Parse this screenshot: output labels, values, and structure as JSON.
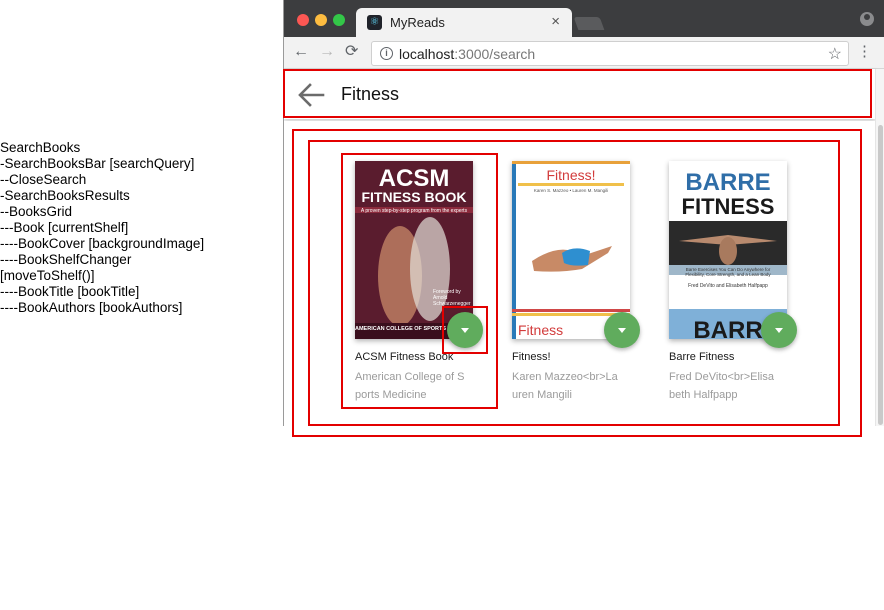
{
  "annotation": {
    "lines": [
      "SearchBooks",
      "-SearchBooksBar [searchQuery]",
      "--CloseSearch",
      "-SearchBooksResults",
      "--BooksGrid",
      "---Book  [currentShelf]",
      "----BookCover [backgroundImage]",
      "----BookShelfChanger",
      "[moveToShelf()]",
      "----BookTitle [bookTitle]",
      "----BookAuthors [bookAuthors]"
    ]
  },
  "browser": {
    "tab_title": "MyReads",
    "tab_close": "×",
    "url_host": "localhost",
    "url_path": ":3000/search",
    "nav_back": "←",
    "nav_forward": "→",
    "nav_reload": "⟳",
    "info": "i",
    "star": "☆",
    "menu": "⋮"
  },
  "search": {
    "query": "Fitness"
  },
  "books": [
    {
      "title": "ACSM Fitness Book",
      "authors": "American College of Sports Medicine",
      "cover": {
        "line1": "ACSM",
        "line2": "FITNESS BOOK",
        "tagline": "A proven step-by-step program from the experts",
        "foreword": "Foreword by Arnold Schwarzenegger",
        "bottom": "AMERICAN COLLEGE OF SPORTS MEDICINE"
      }
    },
    {
      "title": "Fitness!",
      "authors": "Karen Mazzeo<br>Lauren Mangili",
      "cover": {
        "title": "Fitness!",
        "authors": "Karen S. Mazzeo • Lauren M. Mangili",
        "bottom_title": "Fitness"
      }
    },
    {
      "title": "Barre Fitness",
      "authors": "Fred DeVito<br>Elisabeth Halfpapp",
      "cover": {
        "line1": "BARRE",
        "line2": "FITNESS",
        "subtitle": "Barre Exercises You Can Do Anywhere for Flexibility, Core Strength, and a Lean Body",
        "byline": "Fred DeVito and Elisabeth Halfpapp",
        "bottom": "BARR"
      }
    }
  ],
  "colors": {
    "annotation_box": "#e30000",
    "shelf_changer": "#60ac5d",
    "author_text": "#9b9b9b"
  }
}
